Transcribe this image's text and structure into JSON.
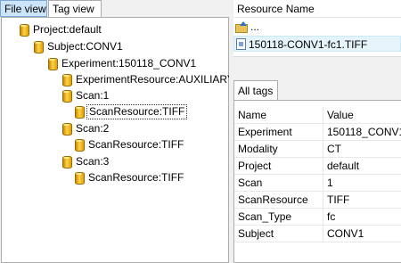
{
  "left_tabs": [
    "File view",
    "Tag view"
  ],
  "tree": {
    "project": "Project:default",
    "subject": "Subject:CONV1",
    "experiment": "Experiment:150118_CONV1",
    "experiment_resource": "ExperimentResource:AUXILIARY",
    "scan1": "Scan:1",
    "scan1_resource": "ScanResource:TIFF",
    "scan2": "Scan:2",
    "scan2_resource": "ScanResource:TIFF",
    "scan3": "Scan:3",
    "scan3_resource": "ScanResource:TIFF"
  },
  "resources": {
    "header": "Resource Name",
    "parent": "...",
    "file": "150118-CONV1-fc1.TIFF"
  },
  "tags_tab": "All tags",
  "tags_table": {
    "columns": [
      "Name",
      "Value"
    ],
    "rows": [
      {
        "name": "Experiment",
        "value": "150118_CONV1"
      },
      {
        "name": "Modality",
        "value": "CT"
      },
      {
        "name": "Project",
        "value": "default"
      },
      {
        "name": "Scan",
        "value": "1"
      },
      {
        "name": "ScanResource",
        "value": "TIFF"
      },
      {
        "name": "Scan_Type",
        "value": "fc"
      },
      {
        "name": "Subject",
        "value": "CONV1"
      }
    ]
  },
  "colors": {
    "selected_tab": "#cce4f7",
    "selected_row": "#e5f3fb",
    "db_icon": "#e0a000"
  }
}
